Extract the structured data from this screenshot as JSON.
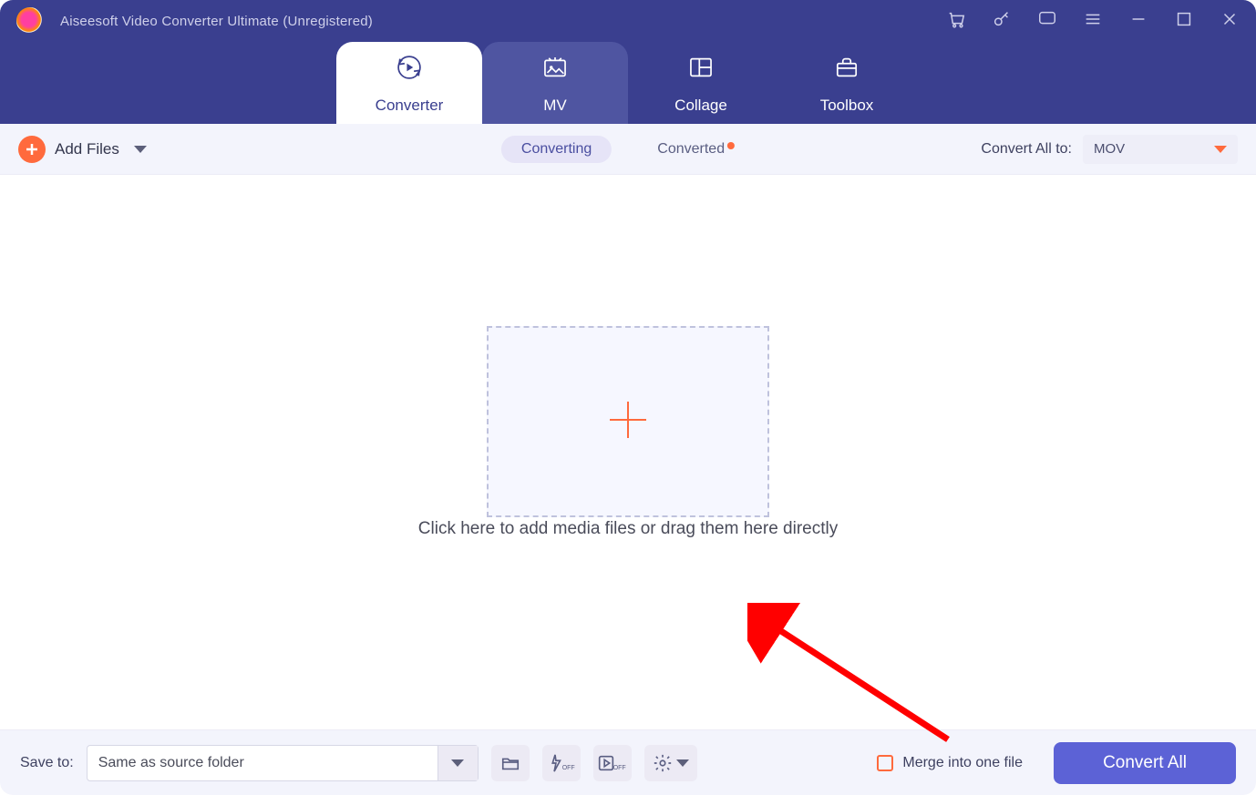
{
  "titlebar": {
    "title": "Aiseesoft Video Converter Ultimate (Unregistered)"
  },
  "tabs": {
    "converter": "Converter",
    "mv": "MV",
    "collage": "Collage",
    "toolbox": "Toolbox"
  },
  "toolbar": {
    "add_files": "Add Files",
    "converting": "Converting",
    "converted": "Converted",
    "convert_all_to": "Convert All to:",
    "format": "MOV"
  },
  "main": {
    "drop_hint": "Click here to add media files or drag them here directly"
  },
  "footer": {
    "save_to": "Save to:",
    "save_path": "Same as source folder",
    "merge": "Merge into one file",
    "convert_all": "Convert All",
    "off": "OFF"
  }
}
